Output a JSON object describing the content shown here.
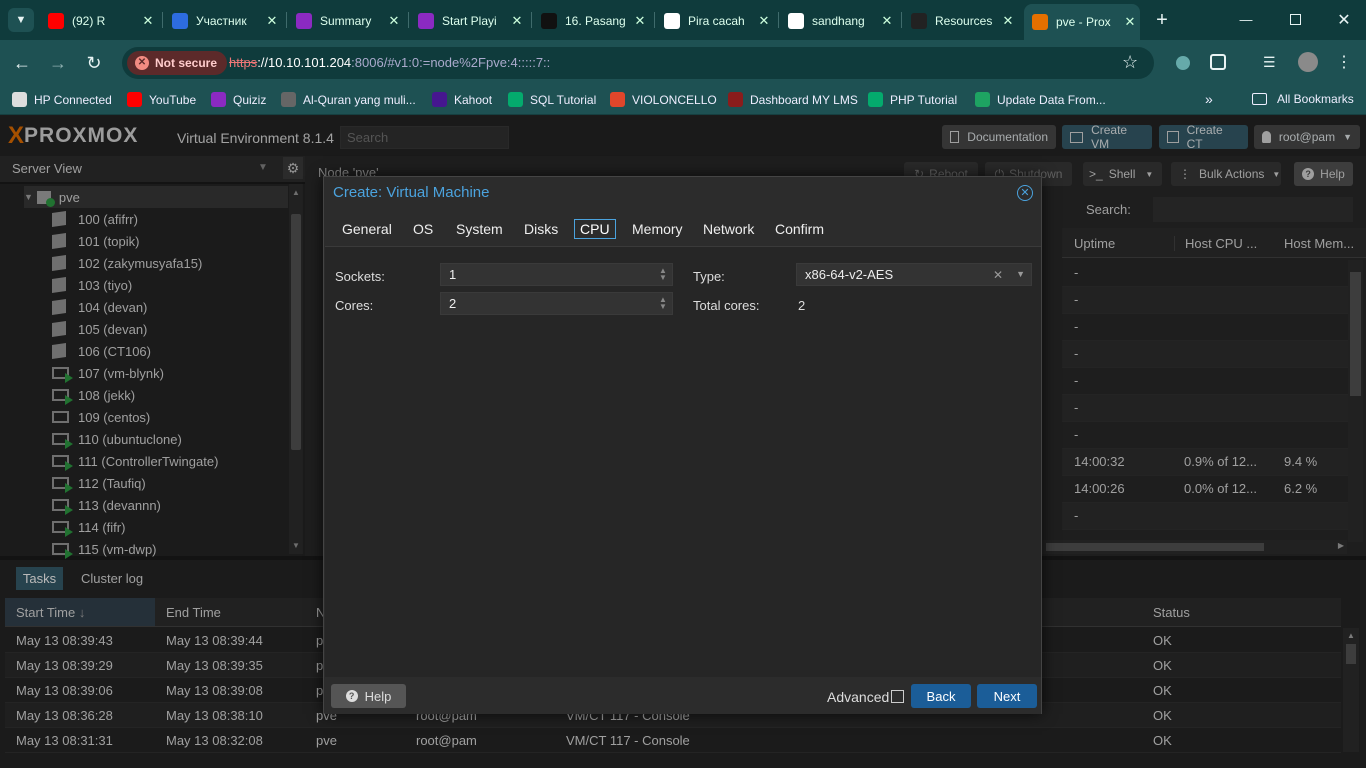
{
  "browser": {
    "tabs": [
      {
        "title": "(92) R",
        "icon": "youtube-icon",
        "color": "#ff0000"
      },
      {
        "title": "Участник",
        "icon": "zoom-icon",
        "color": "#2d6cdf"
      },
      {
        "title": "Summary",
        "icon": "quizizz-icon",
        "color": "#8b2ac2"
      },
      {
        "title": "Start Playi",
        "icon": "quizizz-icon",
        "color": "#8b2ac2"
      },
      {
        "title": "16. Pasang",
        "icon": "b-icon",
        "color": "#111111"
      },
      {
        "title": "Pira cacah",
        "icon": "google-icon",
        "color": "#ffffff"
      },
      {
        "title": "sandhang",
        "icon": "google-icon",
        "color": "#ffffff"
      },
      {
        "title": "Resources",
        "icon": "doc-icon",
        "color": "#222222"
      },
      {
        "title": "pve - Prox",
        "icon": "proxmox-icon",
        "color": "#e57000"
      }
    ],
    "security_label": "Not secure",
    "url_scheme": "https",
    "url_host": "://10.10.101.204",
    "url_rest": ":8006/#v1:0:=node%2Fpve:4:::::7::",
    "bookmarks": [
      {
        "label": "HP Connected",
        "color": "#dddddd"
      },
      {
        "label": "YouTube",
        "color": "#ff0000"
      },
      {
        "label": "Quiziz",
        "color": "#8b2ac2"
      },
      {
        "label": "Al-Quran yang muli...",
        "color": "#666666"
      },
      {
        "label": "Kahoot",
        "color": "#46178f"
      },
      {
        "label": "SQL Tutorial",
        "color": "#04aa6d"
      },
      {
        "label": "VIOLONCELLO",
        "color": "#e0462b"
      },
      {
        "label": "Dashboard MY LMS",
        "color": "#8a1c1c"
      },
      {
        "label": "PHP Tutorial",
        "color": "#04aa6d"
      },
      {
        "label": "Update Data From...",
        "color": "#1ea362"
      }
    ],
    "all_bookmarks": "All Bookmarks"
  },
  "proxmox": {
    "logo": "PROXMOX",
    "product": "Virtual Environment 8.1.4",
    "search_placeholder": "Search",
    "documentation": "Documentation",
    "create_vm": "Create VM",
    "create_ct": "Create CT",
    "user": "root@pam",
    "server_view": "Server View",
    "node_title": "Node 'pve'",
    "reboot": "Reboot",
    "shutdown": "Shutdown",
    "shell": "Shell",
    "bulk_actions": "Bulk Actions",
    "help": "Help",
    "search_label": "Search:",
    "tree_root": "pve",
    "tree": [
      {
        "label": "100 (afifrr)",
        "type": "ct"
      },
      {
        "label": "101 (topik)",
        "type": "ct"
      },
      {
        "label": "102 (zakymusyafa15)",
        "type": "ct"
      },
      {
        "label": "103 (tiyo)",
        "type": "ct"
      },
      {
        "label": "104 (devan)",
        "type": "ct"
      },
      {
        "label": "105 (devan)",
        "type": "ct"
      },
      {
        "label": "106 (CT106)",
        "type": "ct"
      },
      {
        "label": "107 (vm-blynk)",
        "type": "vm-run"
      },
      {
        "label": "108 (jekk)",
        "type": "vm-run"
      },
      {
        "label": "109 (centos)",
        "type": "vm"
      },
      {
        "label": "110 (ubuntuclone)",
        "type": "vm-run"
      },
      {
        "label": "111 (ControllerTwingate)",
        "type": "vm-run"
      },
      {
        "label": "112 (Taufiq)",
        "type": "vm-run"
      },
      {
        "label": "113 (devannn)",
        "type": "vm-run"
      },
      {
        "label": "114 (fifr)",
        "type": "vm-run"
      },
      {
        "label": "115 (vm-dwp)",
        "type": "vm-run"
      }
    ],
    "grid_headers": [
      "Uptime",
      "Host CPU ...",
      "Host Mem..."
    ],
    "grid_rows": [
      [
        "-",
        "",
        ""
      ],
      [
        "-",
        "",
        ""
      ],
      [
        "-",
        "",
        ""
      ],
      [
        "-",
        "",
        ""
      ],
      [
        "-",
        "",
        ""
      ],
      [
        "-",
        "",
        ""
      ],
      [
        "-",
        "",
        ""
      ],
      [
        "14:00:32",
        "0.9% of 12...",
        "9.4 %"
      ],
      [
        "14:00:26",
        "0.0% of 12...",
        "6.2 %"
      ],
      [
        "-",
        "",
        ""
      ]
    ],
    "bottom_tabs": [
      "Tasks",
      "Cluster log"
    ],
    "task_headers": [
      "Start Time",
      "End Time",
      "N",
      "Status"
    ],
    "tasks": [
      {
        "start": "May 13 08:39:43",
        "end": "May 13 08:39:44",
        "node": "pv",
        "user": "",
        "desc": "",
        "status": "OK"
      },
      {
        "start": "May 13 08:39:29",
        "end": "May 13 08:39:35",
        "node": "pv",
        "user": "",
        "desc": "",
        "status": "OK"
      },
      {
        "start": "May 13 08:39:06",
        "end": "May 13 08:39:08",
        "node": "pv",
        "user": "",
        "desc": "",
        "status": "OK"
      },
      {
        "start": "May 13 08:36:28",
        "end": "May 13 08:38:10",
        "node": "pve",
        "user": "root@pam",
        "desc": "VM/CT 117 - Console",
        "status": "OK"
      },
      {
        "start": "May 13 08:31:31",
        "end": "May 13 08:32:08",
        "node": "pve",
        "user": "root@pam",
        "desc": "VM/CT 117 - Console",
        "status": "OK"
      }
    ]
  },
  "dialog": {
    "title": "Create: Virtual Machine",
    "tabs": [
      "General",
      "OS",
      "System",
      "Disks",
      "CPU",
      "Memory",
      "Network",
      "Confirm"
    ],
    "active_tab": "CPU",
    "sockets_label": "Sockets:",
    "sockets_value": "1",
    "cores_label": "Cores:",
    "cores_value": "2",
    "type_label": "Type:",
    "type_value": "x86-64-v2-AES",
    "total_label": "Total cores:",
    "total_value": "2",
    "help": "Help",
    "advanced": "Advanced",
    "back": "Back",
    "next": "Next"
  }
}
